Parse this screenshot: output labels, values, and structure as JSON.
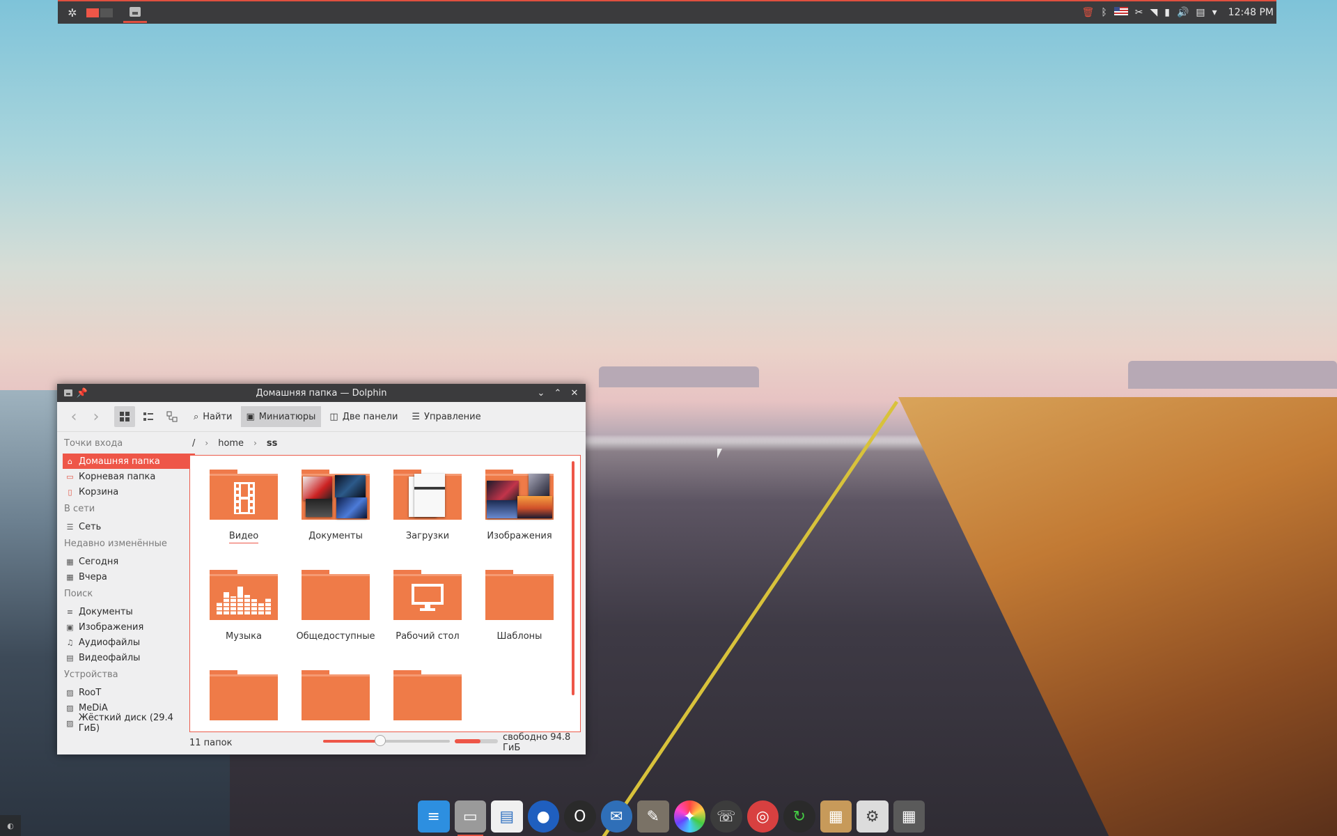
{
  "panel": {
    "menu_icon": "kde-logo-icon",
    "clock": "12:48 PM",
    "tray_icons": [
      "trash-icon",
      "bluetooth-icon",
      "us-flag-icon",
      "clipboard-icon",
      "wifi-icon",
      "battery-icon",
      "volume-icon",
      "notes-icon",
      "expand-arrow-icon"
    ],
    "accent": "#e0503f"
  },
  "window": {
    "title": "Домашняя папка — Dolphin",
    "toolbar": {
      "find": "Найти",
      "thumbnails": "Миниатюры",
      "split": "Две панели",
      "control": "Управление"
    },
    "sidebar": {
      "places_head": "Точки входа",
      "places": [
        "Домашняя папка",
        "Корневая папка",
        "Корзина"
      ],
      "network_head": "В сети",
      "network": [
        "Сеть"
      ],
      "recent_head": "Недавно изменённые",
      "recent": [
        "Сегодня",
        "Вчера"
      ],
      "search_head": "Поиск",
      "search": [
        "Документы",
        "Изображения",
        "Аудиофайлы",
        "Видеофайлы"
      ],
      "devices_head": "Устройства",
      "devices": [
        "RooT",
        "MeDiA",
        "Жёсткий диск (29.4 ГиБ)"
      ]
    },
    "breadcrumb": {
      "root": "/",
      "home": "home",
      "current": "ss"
    },
    "folders": [
      "Видео",
      "Документы",
      "Загрузки",
      "Изображения",
      "Музыка",
      "Общедоступные",
      "Рабочий стол",
      "Шаблоны"
    ],
    "status": {
      "count": "11 папок",
      "free": "свободно 94.8 ГиБ",
      "zoom_fraction": 0.45,
      "used_fraction": 0.6
    },
    "folder_color": "#ef7b48",
    "selection_color": "#ee5648"
  },
  "dock": {
    "items": [
      "text-editor-icon",
      "file-manager-icon",
      "kanban-icon",
      "firefox-icon",
      "opera-icon",
      "thunderbird-icon",
      "gimp-icon",
      "color-picker-icon",
      "skype-icon",
      "disc-burner-icon",
      "update-icon",
      "package-icon",
      "settings-icon",
      "calculator-icon"
    ]
  }
}
